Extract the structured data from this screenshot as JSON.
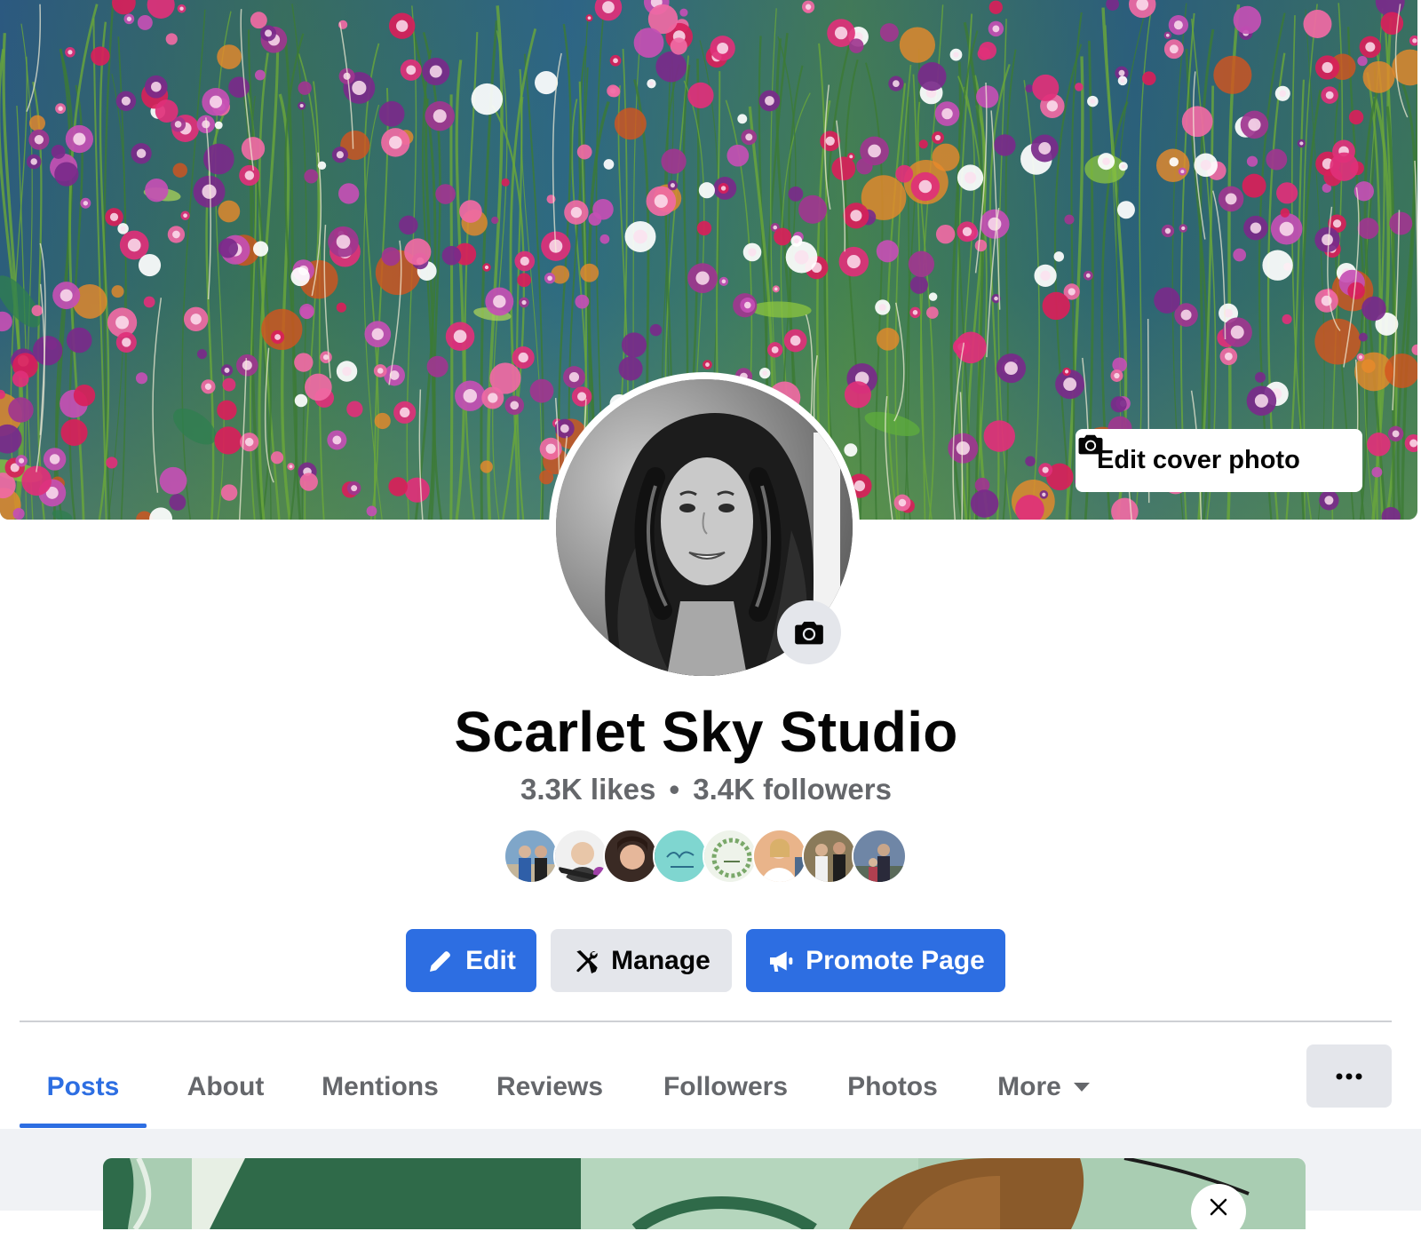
{
  "cover": {
    "edit_label": "Edit cover photo",
    "edit_icon": "camera-icon"
  },
  "profile": {
    "camera_icon": "camera-icon",
    "name": "Scarlet Sky Studio",
    "likes": "3.3K likes",
    "separator": "•",
    "followers": "3.4K followers"
  },
  "actions": {
    "edit_label": "Edit",
    "manage_label": "Manage",
    "promote_label": "Promote Page"
  },
  "tabs": {
    "posts": "Posts",
    "about": "About",
    "mentions": "Mentions",
    "reviews": "Reviews",
    "followers": "Followers",
    "photos": "Photos",
    "more": "More"
  },
  "colors": {
    "accent": "#2d6ee2",
    "secondary_button": "#e4e6eb",
    "muted_text": "#65676b",
    "feed_background": "#f0f2f5"
  }
}
